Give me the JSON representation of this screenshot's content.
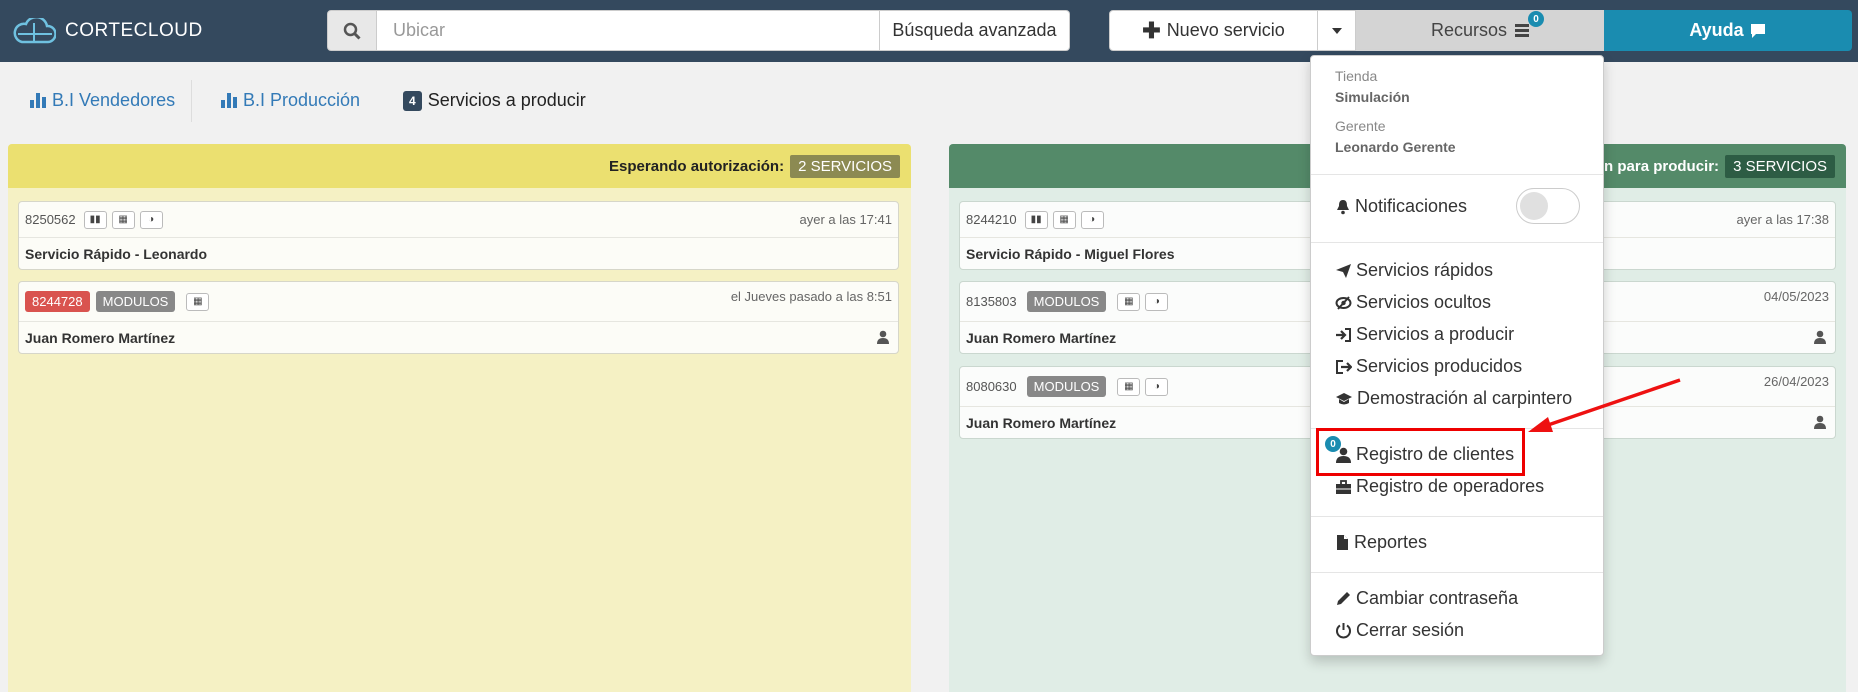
{
  "topbar": {
    "brand": "CORTECLOUD",
    "search_placeholder": "Ubicar",
    "advanced_search": "Búsqueda avanzada",
    "new_service": "Nuevo servicio",
    "resources": "Recursos",
    "resources_badge": "0",
    "help": "Ayuda"
  },
  "subnav": {
    "bi_sellers": "B.I Vendedores",
    "bi_production": "B.I Producción",
    "services_count": "4",
    "services_label": "Servicios a producir"
  },
  "left_column": {
    "header": "Esperando autorización:",
    "badge": "2 SERVICIOS",
    "cards": [
      {
        "id": "8250562",
        "time": "ayer a las 17:41",
        "name": "Servicio Rápido - Leonardo"
      },
      {
        "id": "8244728",
        "tag": "MODULOS",
        "time": "el Jueves pasado a las 8:51",
        "name": "Juan Romero Martínez"
      }
    ]
  },
  "right_column": {
    "header": "ón para producir:",
    "badge": "3 SERVICIOS",
    "cards": [
      {
        "id": "8244210",
        "time": "ayer a las 17:38",
        "name": "Servicio Rápido - Miguel Flores"
      },
      {
        "id": "8135803",
        "tag": "MODULOS",
        "time": "04/05/2023",
        "name": "Juan Romero Martínez"
      },
      {
        "id": "8080630",
        "tag": "MODULOS",
        "time": "26/04/2023",
        "name": "Juan Romero Martínez"
      }
    ]
  },
  "menu": {
    "store_label": "Tienda",
    "store_value": "Simulación",
    "manager_label": "Gerente",
    "manager_value": "Leonardo Gerente",
    "notifications": "Notificaciones",
    "items_group1": [
      "Servicios rápidos",
      "Servicios ocultos",
      "Servicios a producir",
      "Servicios producidos",
      "Demostración al carpintero"
    ],
    "client_registry": "Registro de clientes",
    "client_badge": "0",
    "operator_registry": "Registro de operadores",
    "reports": "Reportes",
    "change_password": "Cambiar contraseña",
    "logout": "Cerrar sesión"
  },
  "colors": {
    "topbar": "#34495e",
    "accent": "#1a8cb0",
    "annotation": "#ee0000"
  }
}
